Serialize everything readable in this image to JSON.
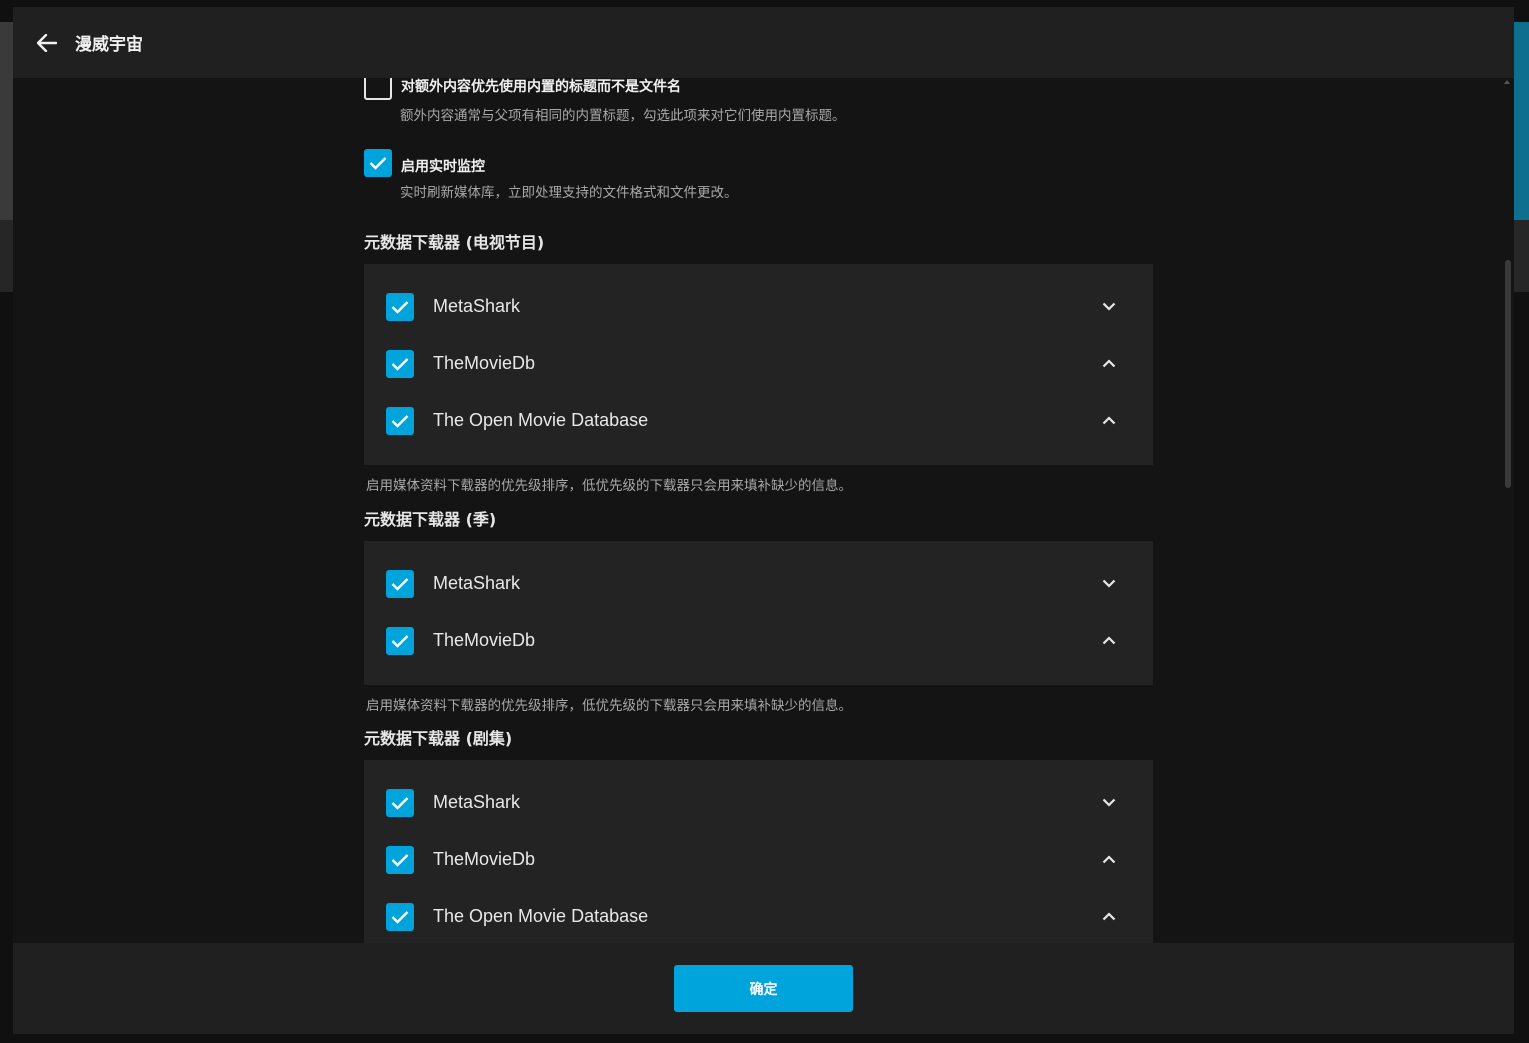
{
  "header": {
    "title": "漫威宇宙"
  },
  "options": [
    {
      "label": "对额外内容优先使用内置的标题而不是文件名",
      "description": "额外内容通常与父项有相同的内置标题，勾选此项来对它们使用内置标题。",
      "checked": false
    },
    {
      "label": "启用实时监控",
      "description": "实时刷新媒体库，立即处理支持的文件格式和文件更改。",
      "checked": true
    }
  ],
  "sections": [
    {
      "title": "元数据下载器 (电视节目)",
      "items": [
        {
          "label": "MetaShark",
          "checked": true,
          "chevron": "chevron-down-icon"
        },
        {
          "label": "TheMovieDb",
          "checked": true,
          "chevron": "chevron-up-icon"
        },
        {
          "label": "The Open Movie Database",
          "checked": true,
          "chevron": "chevron-up-icon"
        }
      ],
      "help": "启用媒体资料下载器的优先级排序，低优先级的下载器只会用来填补缺少的信息。"
    },
    {
      "title": "元数据下载器 (季)",
      "items": [
        {
          "label": "MetaShark",
          "checked": true,
          "chevron": "chevron-down-icon"
        },
        {
          "label": "TheMovieDb",
          "checked": true,
          "chevron": "chevron-up-icon"
        }
      ],
      "help": "启用媒体资料下载器的优先级排序，低优先级的下载器只会用来填补缺少的信息。"
    },
    {
      "title": "元数据下载器 (剧集)",
      "items": [
        {
          "label": "MetaShark",
          "checked": true,
          "chevron": "chevron-down-icon"
        },
        {
          "label": "TheMovieDb",
          "checked": true,
          "chevron": "chevron-up-icon"
        },
        {
          "label": "The Open Movie Database",
          "checked": true,
          "chevron": "chevron-up-icon"
        }
      ]
    }
  ],
  "footer": {
    "ok_label": "确定"
  },
  "colors": {
    "accent": "#00a4dc",
    "panel": "#232323",
    "header": "#202020"
  }
}
